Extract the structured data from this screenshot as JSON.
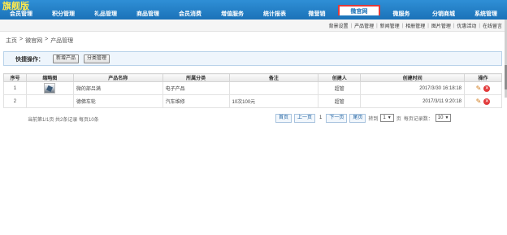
{
  "logo": "旗舰版",
  "nav": [
    {
      "label": "会员管理"
    },
    {
      "label": "积分管理"
    },
    {
      "label": "礼品管理"
    },
    {
      "label": "商品管理"
    },
    {
      "label": "会员消费"
    },
    {
      "label": "增值服务"
    },
    {
      "label": "统计报表"
    },
    {
      "label": "微营销"
    },
    {
      "label": "微官网",
      "active": true
    },
    {
      "label": "微服务"
    },
    {
      "label": "分销商城"
    },
    {
      "label": "系统管理"
    }
  ],
  "subnav": [
    "背景设置",
    "产品管理",
    "新闻管理",
    "相册管理",
    "图片管理",
    "优惠活动",
    "在线留言"
  ],
  "breadcrumb": [
    "主页",
    "微官网",
    "产品管理"
  ],
  "breadcrumb_sep": ">",
  "quick": {
    "label": "快捷操作：",
    "add_button": "新增产品",
    "category_button": "分类管理"
  },
  "table": {
    "headers": [
      "序号",
      "缩略图",
      "产品名称",
      "所属分类",
      "备注",
      "创建人",
      "创建时间",
      "操作"
    ],
    "rows": [
      {
        "index": "1",
        "name": "微的部吕满",
        "category": "电子产品",
        "remark": "",
        "creator": "超管",
        "created": "2017/3/30 16:18:18"
      },
      {
        "index": "2",
        "name": "德佛车轮",
        "category": "汽车维修",
        "remark": "10次100元",
        "creator": "超管",
        "created": "2017/3/11 9:20:18"
      }
    ]
  },
  "pager": {
    "info": "当前第1/1页 共2条记录 每页10条",
    "first": "首页",
    "prev": "上一页",
    "current": "1",
    "next": "下一页",
    "last": "尾页",
    "goto_label": "转到",
    "goto_value": "1",
    "page_suffix": "页",
    "per_page_label": "每页记录数：",
    "per_page_value": "10"
  },
  "colors": {
    "nav_bg": "#1b72b8",
    "active_border": "#e23a3a",
    "logo": "#ffe94d"
  }
}
